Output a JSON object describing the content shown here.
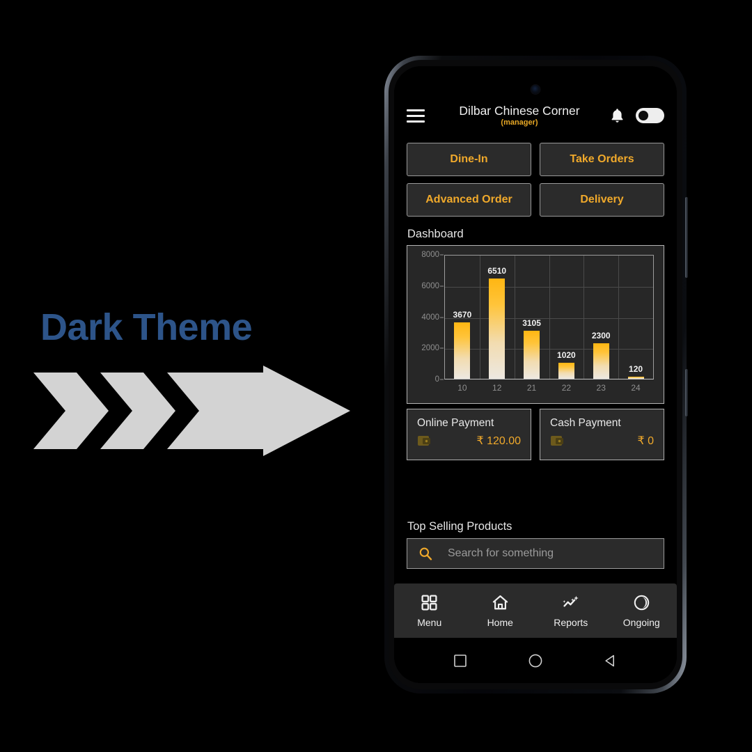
{
  "promo": {
    "headline": "Dark Theme",
    "arrow_color": "#d3d3d3",
    "headline_color": "#2d5489"
  },
  "phone": {
    "camera": "front-camera",
    "system_nav": {
      "recents": "square-icon",
      "home": "circle-icon",
      "back": "triangle-back-icon"
    }
  },
  "app": {
    "header": {
      "menu_icon": "hamburger-icon",
      "title": "Dilbar Chinese Corner",
      "subtitle": "(manager)",
      "bell_icon": "bell-icon",
      "theme_toggle_state": "off"
    },
    "quick_actions": [
      {
        "label": "Dine-In"
      },
      {
        "label": "Take Orders"
      },
      {
        "label": "Advanced Order"
      },
      {
        "label": "Delivery"
      }
    ],
    "dashboard_label": "Dashboard",
    "payments": [
      {
        "title": "Online Payment",
        "amount": "₹ 120.00",
        "icon": "wallet-icon"
      },
      {
        "title": "Cash Payment",
        "amount": "₹ 0",
        "icon": "wallet-icon"
      }
    ],
    "top_selling_label": "Top Selling Products",
    "search": {
      "placeholder": "Search for something",
      "value": "",
      "icon": "search-icon"
    },
    "bottom_nav": [
      {
        "label": "Menu",
        "icon": "grid-icon"
      },
      {
        "label": "Home",
        "icon": "home-icon"
      },
      {
        "label": "Reports",
        "icon": "analytics-sparkle-icon"
      },
      {
        "label": "Ongoing",
        "icon": "clock-moon-icon"
      }
    ],
    "colors": {
      "accent": "#f0a92b",
      "bar_top": "#FFB612",
      "bar_bottom": "#EDE8E1",
      "surface": "#2b2b2b",
      "background": "#000000"
    }
  },
  "chart_data": {
    "type": "bar",
    "title": "Dashboard",
    "categories": [
      "10",
      "12",
      "21",
      "22",
      "23",
      "24"
    ],
    "values": [
      3670,
      6510,
      3105,
      1020,
      2300,
      120
    ],
    "labels": [
      "3670",
      "6510",
      "3105",
      "1020",
      "2300",
      "120"
    ],
    "yticks": [
      0,
      2000,
      4000,
      6000,
      8000
    ],
    "yticklabels": [
      "0",
      "2000",
      "4000",
      "6000",
      "8000"
    ],
    "ylim": [
      0,
      8000
    ],
    "xlabel": "",
    "ylabel": "",
    "grid": true,
    "legend": false
  }
}
